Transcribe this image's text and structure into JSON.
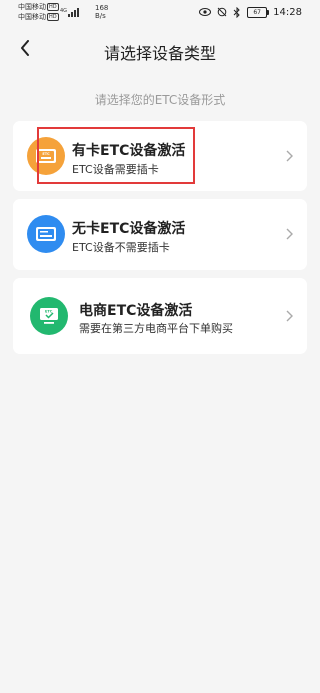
{
  "status_bar": {
    "carrier1": "中国移动",
    "carrier1_badge": "HD",
    "carrier2": "中国移动",
    "carrier2_badge": "HD",
    "speed_value": "168",
    "speed_unit": "B/s",
    "battery": "67",
    "time": "14:28"
  },
  "header": {
    "title": "请选择设备类型"
  },
  "subtitle": "请选择您的ETC设备形式",
  "options": [
    {
      "title": "有卡ETC设备激活",
      "desc": "ETC设备需要插卡",
      "icon_color": "#f5a23a"
    },
    {
      "title": "无卡ETC设备激活",
      "desc": "ETC设备不需要插卡",
      "icon_color": "#2f8cf0"
    },
    {
      "title": "电商ETC设备激活",
      "desc": "需要在第三方电商平台下单购买",
      "icon_color": "#22b86f"
    }
  ],
  "icon_labels": {
    "card": "ETC",
    "screen": "ETC"
  },
  "colors": {
    "highlight": "#e23a3a",
    "background": "#f5f5f5"
  }
}
